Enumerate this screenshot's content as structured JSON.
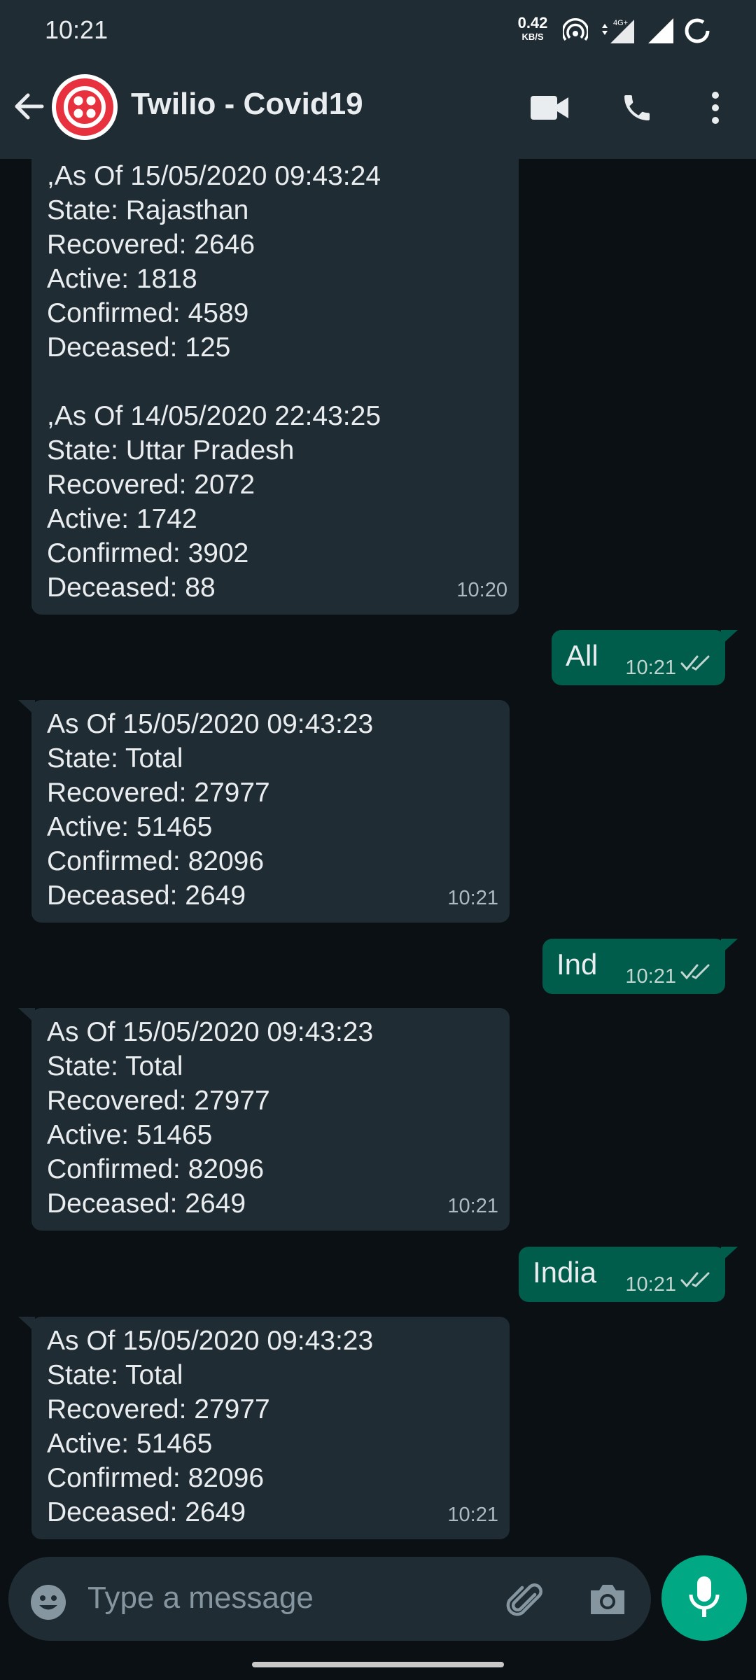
{
  "status_bar": {
    "time": "10:21",
    "net_speed": "0.42",
    "net_unit": "KB/S",
    "network_type": "4G+"
  },
  "header": {
    "back_icon": "arrow-left-icon",
    "contact_name": "Twilio - Covid19",
    "video_icon": "video-camera-icon",
    "call_icon": "phone-icon",
    "menu_icon": "more-vert-icon"
  },
  "messages": [
    {
      "direction": "in",
      "lines": [
        ",As Of 15/05/2020 09:43:24",
        "State: Rajasthan",
        "Recovered: 2646",
        "Active: 1818",
        "Confirmed: 4589",
        "Deceased: 125",
        "",
        ",As Of 14/05/2020 22:43:25",
        "State: Uttar Pradesh",
        "Recovered: 2072",
        "Active: 1742",
        "Confirmed: 3902",
        "Deceased: 88"
      ],
      "time": "10:20"
    },
    {
      "direction": "out",
      "text": "All",
      "time": "10:21"
    },
    {
      "direction": "in",
      "lines": [
        "As Of 15/05/2020 09:43:23",
        "State: Total",
        "Recovered: 27977",
        "Active: 51465",
        "Confirmed: 82096",
        "Deceased: 2649"
      ],
      "time": "10:21"
    },
    {
      "direction": "out",
      "text": "Ind",
      "time": "10:21"
    },
    {
      "direction": "in",
      "lines": [
        "As Of 15/05/2020 09:43:23",
        "State: Total",
        "Recovered: 27977",
        "Active: 51465",
        "Confirmed: 82096",
        "Deceased: 2649"
      ],
      "time": "10:21"
    },
    {
      "direction": "out",
      "text": "India",
      "time": "10:21"
    },
    {
      "direction": "in",
      "lines": [
        "As Of 15/05/2020 09:43:23",
        "State: Total",
        "Recovered: 27977",
        "Active: 51465",
        "Confirmed: 82096",
        "Deceased: 2649"
      ],
      "time": "10:21"
    }
  ],
  "composer": {
    "placeholder": "Type a message",
    "emoji_icon": "emoji-icon",
    "attach_icon": "paperclip-icon",
    "camera_icon": "camera-icon",
    "mic_icon": "microphone-icon"
  },
  "colors": {
    "incoming_bubble": "#202c33",
    "outgoing_bubble": "#005c4b",
    "accent": "#00a884",
    "background": "#0b1014"
  }
}
